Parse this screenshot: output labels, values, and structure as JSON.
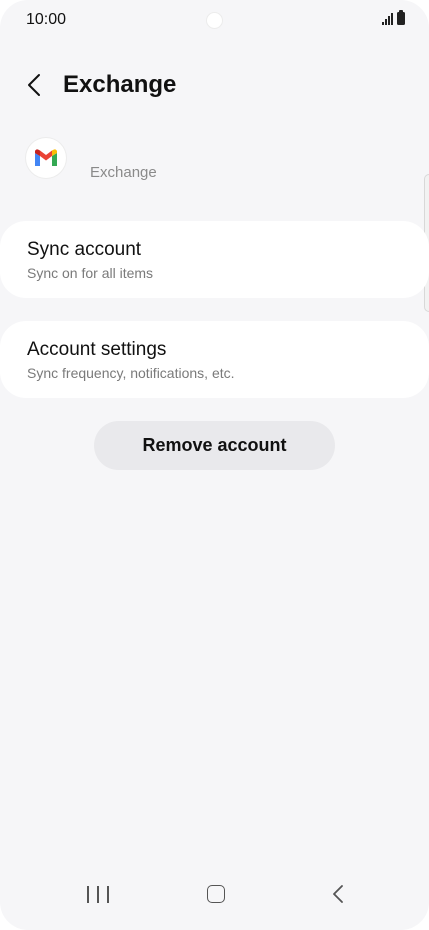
{
  "status_bar": {
    "time": "10:00",
    "icons": [
      "signal-icon",
      "battery-icon"
    ]
  },
  "header": {
    "back_icon": "chevron-left-icon",
    "title": "Exchange"
  },
  "account": {
    "logo": "gmail-logo",
    "type_label": "Exchange"
  },
  "settings": {
    "sync": {
      "title": "Sync account",
      "subtitle": "Sync on for all items"
    },
    "account_settings": {
      "title": "Account settings",
      "subtitle": "Sync frequency, notifications, etc."
    }
  },
  "actions": {
    "remove_label": "Remove account"
  },
  "nav_bar": {
    "icons": [
      "recents-icon",
      "home-icon",
      "back-icon"
    ]
  },
  "colors": {
    "background": "#f6f6f8",
    "card": "#ffffff",
    "button": "#e9e9ec",
    "text_primary": "#111111",
    "text_secondary": "#7a7a7a"
  }
}
